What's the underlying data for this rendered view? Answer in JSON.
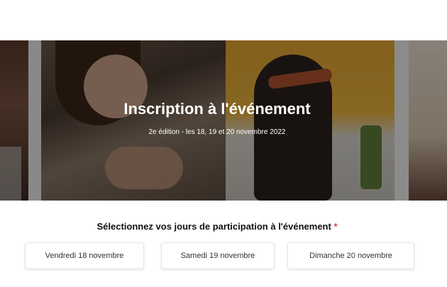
{
  "hero": {
    "title": "Inscription à l'événement",
    "subtitle": "2e édition - les 18, 19 et 20 novembre 2022"
  },
  "days_section": {
    "title": "Sélectionnez vos jours de participation à l'événement",
    "required_marker": "*",
    "days": [
      {
        "label": "Vendredi 18 novembre"
      },
      {
        "label": "Samedi 19 novembre"
      },
      {
        "label": "Dimanche 20 novembre"
      }
    ]
  },
  "colors": {
    "accent_required": "#e53935",
    "overlay": "rgba(0,0,0,0.42)"
  }
}
